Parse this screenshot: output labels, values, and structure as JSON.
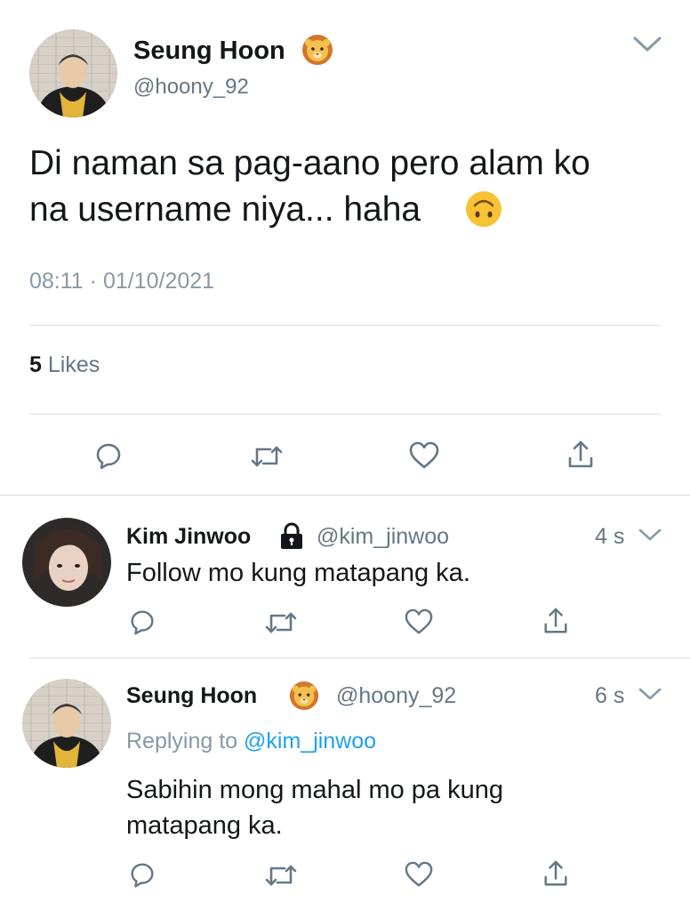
{
  "main_tweet": {
    "display_name": "Seung Hoon",
    "handle": "@hoony_92",
    "text_line1": "Di naman sa pag-aano pero alam ko",
    "text_line2": "na username niya... haha",
    "time": "08:11",
    "separator": "·",
    "date": "01/10/2021",
    "likes_count": "5",
    "likes_label": "Likes",
    "name_emoji": "lion-face",
    "text_emoji": "upside-down-face"
  },
  "replies": [
    {
      "display_name": "Kim Jinwoo",
      "handle": "@kim_jinwoo",
      "time_ago": "4 s",
      "text": "Follow mo kung matapang ka.",
      "badge": "lock-icon"
    },
    {
      "display_name": "Seung Hoon",
      "handle": "@hoony_92",
      "time_ago": "6 s",
      "replying_label": "Replying to",
      "replying_handle": "@kim_jinwoo",
      "text_line1": "Sabihin mong mahal mo pa kung",
      "text_line2": "matapang ka.",
      "name_emoji": "lion-face"
    }
  ],
  "colors": {
    "text": "#14171a",
    "secondary": "#657786",
    "link": "#1da1f2",
    "divider": "#d8dde1",
    "emoji_yellow": "#f7c233"
  },
  "icons": [
    "reply-icon",
    "retweet-icon",
    "like-icon",
    "share-icon",
    "chevron-down-icon",
    "lock-icon"
  ]
}
